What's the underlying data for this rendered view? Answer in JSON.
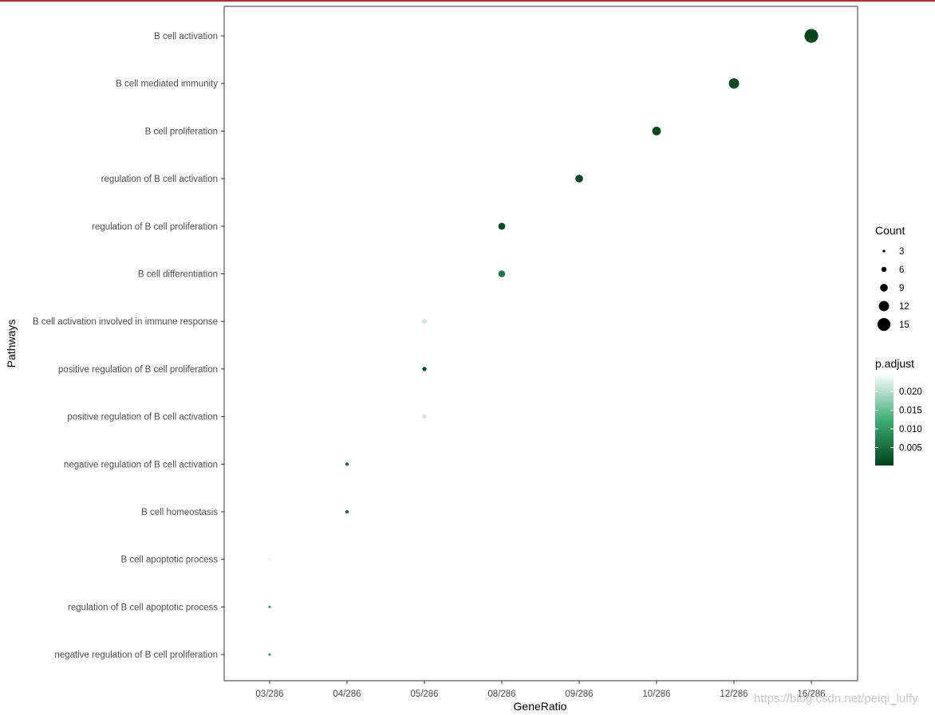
{
  "chart_data": {
    "type": "scatter",
    "xlabel": "GeneRatio",
    "ylabel": "Pathways",
    "x_categories": [
      "03/286",
      "04/286",
      "05/286",
      "08/286",
      "09/286",
      "10/286",
      "12/286",
      "16/286"
    ],
    "grid": false,
    "legend_placement": "right",
    "points": [
      {
        "pathway": "B cell activation",
        "gene_ratio": "16/286",
        "count": 16,
        "p_adjust": 0.0003
      },
      {
        "pathway": "B cell mediated immunity",
        "gene_ratio": "12/286",
        "count": 12,
        "p_adjust": 0.0005
      },
      {
        "pathway": "B cell proliferation",
        "gene_ratio": "10/286",
        "count": 10,
        "p_adjust": 0.0003
      },
      {
        "pathway": "regulation of B cell activation",
        "gene_ratio": "09/286",
        "count": 9,
        "p_adjust": 0.0008
      },
      {
        "pathway": "regulation of B cell proliferation",
        "gene_ratio": "08/286",
        "count": 8,
        "p_adjust": 0.0006
      },
      {
        "pathway": "B cell differentiation",
        "gene_ratio": "08/286",
        "count": 8,
        "p_adjust": 0.006
      },
      {
        "pathway": "B cell activation involved in immune response",
        "gene_ratio": "05/286",
        "count": 5,
        "p_adjust": 0.0215
      },
      {
        "pathway": "positive regulation of B cell proliferation",
        "gene_ratio": "05/286",
        "count": 5,
        "p_adjust": 0.0012
      },
      {
        "pathway": "positive regulation of B cell activation",
        "gene_ratio": "05/286",
        "count": 5,
        "p_adjust": 0.0215
      },
      {
        "pathway": "negative regulation of B cell activation",
        "gene_ratio": "04/286",
        "count": 4,
        "p_adjust": 0.0045
      },
      {
        "pathway": "B cell homeostasis",
        "gene_ratio": "04/286",
        "count": 4,
        "p_adjust": 0.0045
      },
      {
        "pathway": "B cell apoptotic process",
        "gene_ratio": "03/286",
        "count": 3,
        "p_adjust": 0.0235
      },
      {
        "pathway": "regulation of B cell apoptotic process",
        "gene_ratio": "03/286",
        "count": 3,
        "p_adjust": 0.0105
      },
      {
        "pathway": "negative regulation of B cell proliferation",
        "gene_ratio": "03/286",
        "count": 3,
        "p_adjust": 0.0105
      }
    ],
    "size_legend": {
      "title": "Count",
      "values": [
        3,
        6,
        9,
        12,
        15
      ]
    },
    "color_legend": {
      "title": "p.adjust",
      "ticks": [
        0.02,
        0.015,
        0.01,
        0.005
      ],
      "tick_labels": [
        "0.020",
        "0.015",
        "0.010",
        "0.005"
      ],
      "range": [
        0.0002,
        0.0245
      ],
      "low_color": "#00441b",
      "mid_color": "#41ae76",
      "high_color": "#f7fcfd"
    }
  },
  "watermark": "https://blog.csdn.net/peiqi_luffy"
}
